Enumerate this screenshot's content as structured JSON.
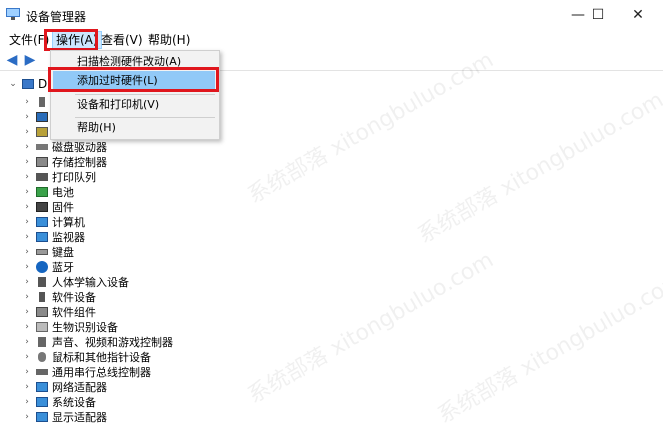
{
  "window": {
    "title": "设备管理器",
    "controls": {
      "minimize": "—",
      "maximize": "☐",
      "close": "✕"
    }
  },
  "menubar": {
    "items": [
      {
        "label": "文件(F)"
      },
      {
        "label": "操作(A)"
      },
      {
        "label": "查看(V)"
      },
      {
        "label": "帮助(H)"
      }
    ]
  },
  "dropdown": {
    "items": [
      {
        "label": "扫描检测硬件改动(A)"
      },
      {
        "label": "添加过时硬件(L)"
      },
      {
        "label": "设备和打印机(V)"
      },
      {
        "label": "帮助(H)"
      }
    ]
  },
  "tree": {
    "root_label": "D",
    "items": [
      {
        "label": ""
      },
      {
        "label": ""
      },
      {
        "label": ""
      },
      {
        "label": "磁盘驱动器"
      },
      {
        "label": "存储控制器"
      },
      {
        "label": "打印队列"
      },
      {
        "label": "电池"
      },
      {
        "label": "固件"
      },
      {
        "label": "计算机"
      },
      {
        "label": "监视器"
      },
      {
        "label": "键盘"
      },
      {
        "label": "蓝牙"
      },
      {
        "label": "人体学输入设备"
      },
      {
        "label": "软件设备"
      },
      {
        "label": "软件组件"
      },
      {
        "label": "生物识别设备"
      },
      {
        "label": "声音、视频和游戏控制器"
      },
      {
        "label": "鼠标和其他指针设备"
      },
      {
        "label": "通用串行总线控制器"
      },
      {
        "label": "网络适配器"
      },
      {
        "label": "系统设备"
      },
      {
        "label": "显示适配器"
      }
    ]
  },
  "watermark": "系统部落 xitongbuluo.com",
  "colors": {
    "highlight": "#91c9f7",
    "annotation": "#e0161d",
    "menu_active": "#cce8ff"
  }
}
